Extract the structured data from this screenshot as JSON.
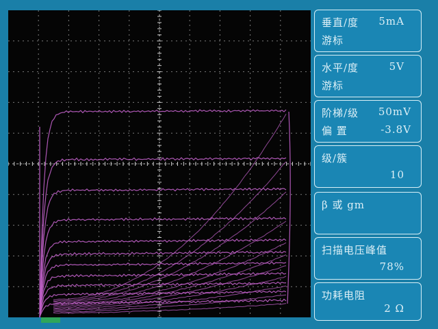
{
  "panels": {
    "vertical": {
      "label": "垂直/度",
      "value": "5mA",
      "sub": "游标"
    },
    "horizontal": {
      "label": "水平/度",
      "value": "5V",
      "sub": "游标"
    },
    "step": {
      "label": "阶梯/级",
      "value": "50mV",
      "offset_label": "偏 置",
      "offset_value": "-3.8V"
    },
    "steps_per_cluster": {
      "label": "级/簇",
      "value": "10"
    },
    "beta": {
      "label": "β 或 gm"
    },
    "sweep": {
      "label": "扫描电压峰值",
      "value": "78%"
    },
    "power": {
      "label": "功耗电阻",
      "value": "2 Ω"
    }
  },
  "colors": {
    "trace": "#c060c8",
    "grid": "#9a9a9a",
    "panel_bg": "#1a86b4",
    "panel_border": "#d8f0f8",
    "background": "#1a7fa8"
  }
}
